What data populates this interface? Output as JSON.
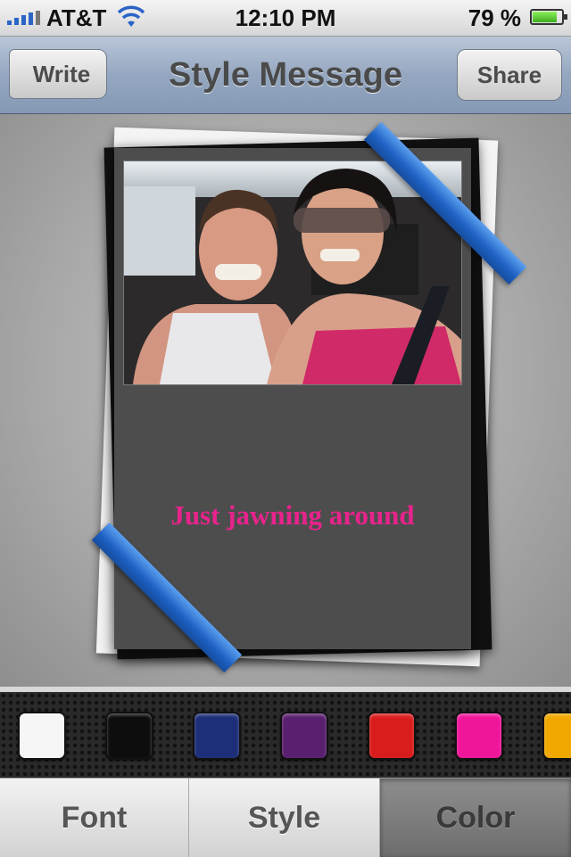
{
  "status_bar": {
    "carrier": "AT&T",
    "time": "12:10 PM",
    "battery_percent": "79 %",
    "battery_level": 0.79
  },
  "nav": {
    "title": "Style Message",
    "back_label": "Write",
    "share_label": "Share"
  },
  "card": {
    "message": "Just jawning around",
    "message_color": "#e8238c",
    "background_color": "#4d4d4d",
    "ribbon_color": "#2f72d8"
  },
  "palette": {
    "colors": [
      "#f6f6f6",
      "#0d0d0d",
      "#1d2f78",
      "#5a1f6e",
      "#d91d1d",
      "#f0169a",
      "#f0a800"
    ],
    "selected_index": 5
  },
  "tabs": [
    {
      "label": "Font"
    },
    {
      "label": "Style"
    },
    {
      "label": "Color"
    }
  ],
  "active_tab": "Color"
}
